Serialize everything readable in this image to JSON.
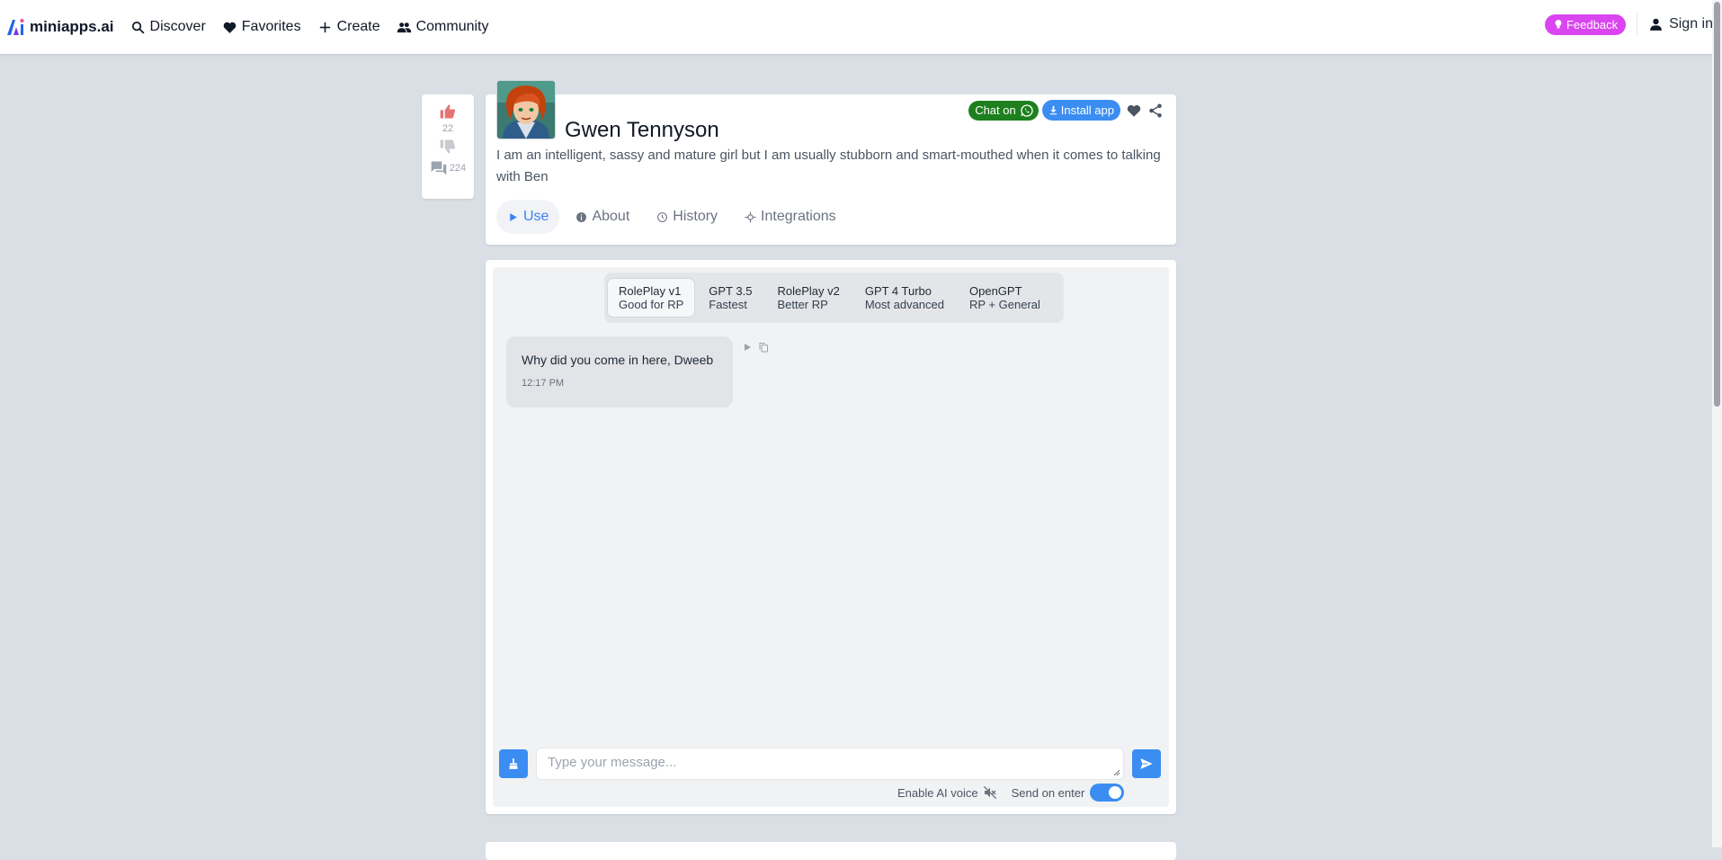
{
  "nav": {
    "brand": "miniapps.ai",
    "discover": "Discover",
    "favorites": "Favorites",
    "create": "Create",
    "community": "Community",
    "feedback": "Feedback",
    "sign_in": "Sign in"
  },
  "votes": {
    "likes": "22",
    "comments": "224"
  },
  "app": {
    "title": "Gwen Tennyson",
    "description": "I am an intelligent, sassy and mature girl but I am usually stubborn and smart-mouthed when it comes to talking with Ben",
    "chat_on": "Chat on",
    "install": "Install app"
  },
  "tabs": [
    {
      "label": "Use",
      "icon": "play-icon",
      "active": true
    },
    {
      "label": "About",
      "icon": "info-icon",
      "active": false
    },
    {
      "label": "History",
      "icon": "history-icon",
      "active": false
    },
    {
      "label": "Integrations",
      "icon": "integrations-icon",
      "active": false
    }
  ],
  "models": [
    {
      "name": "RolePlay v1",
      "sub": "Good for RP",
      "selected": true
    },
    {
      "name": "GPT 3.5",
      "sub": "Fastest",
      "selected": false
    },
    {
      "name": "RolePlay v2",
      "sub": "Better RP",
      "selected": false
    },
    {
      "name": "GPT 4 Turbo",
      "sub": "Most advanced",
      "selected": false
    },
    {
      "name": "OpenGPT",
      "sub": "RP + General",
      "selected": false
    }
  ],
  "messages": [
    {
      "text": "Why did you come in here, Dweeb",
      "time": "12:17 PM"
    }
  ],
  "composer": {
    "placeholder": "Type your message...",
    "enable_voice": "Enable AI voice",
    "send_on_enter": "Send on enter",
    "send_on_enter_on": true
  },
  "colors": {
    "accent": "#3b8df2",
    "whatsapp": "#1e7f1e",
    "feedback": "#d946ef",
    "like": "#e57373"
  }
}
